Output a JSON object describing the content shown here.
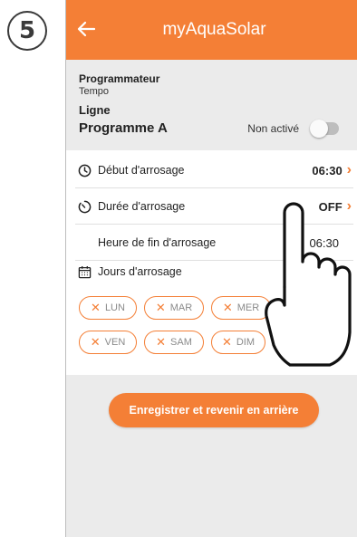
{
  "step": "5",
  "appbar": {
    "title": "myAquaSolar"
  },
  "header": {
    "section_label": "Programmateur",
    "section_sub": "Tempo",
    "line_label": "Ligne",
    "program_name": "Programme A",
    "status_text": "Non activé",
    "active": false
  },
  "rows": {
    "start": {
      "label": "Début d'arrosage",
      "value": "06:30"
    },
    "duration": {
      "label": "Durée d'arrosage",
      "value": "OFF"
    },
    "end": {
      "label": "Heure de fin d'arrosage",
      "value": "06:30"
    }
  },
  "days": {
    "title": "Jours d'arrosage",
    "chips": [
      "LUN",
      "MAR",
      "MER",
      "VEN",
      "SAM",
      "DIM"
    ]
  },
  "save_button": "Enregistrer et revenir en arrière",
  "colors": {
    "accent": "#f47f36",
    "background": "#ebebeb"
  }
}
